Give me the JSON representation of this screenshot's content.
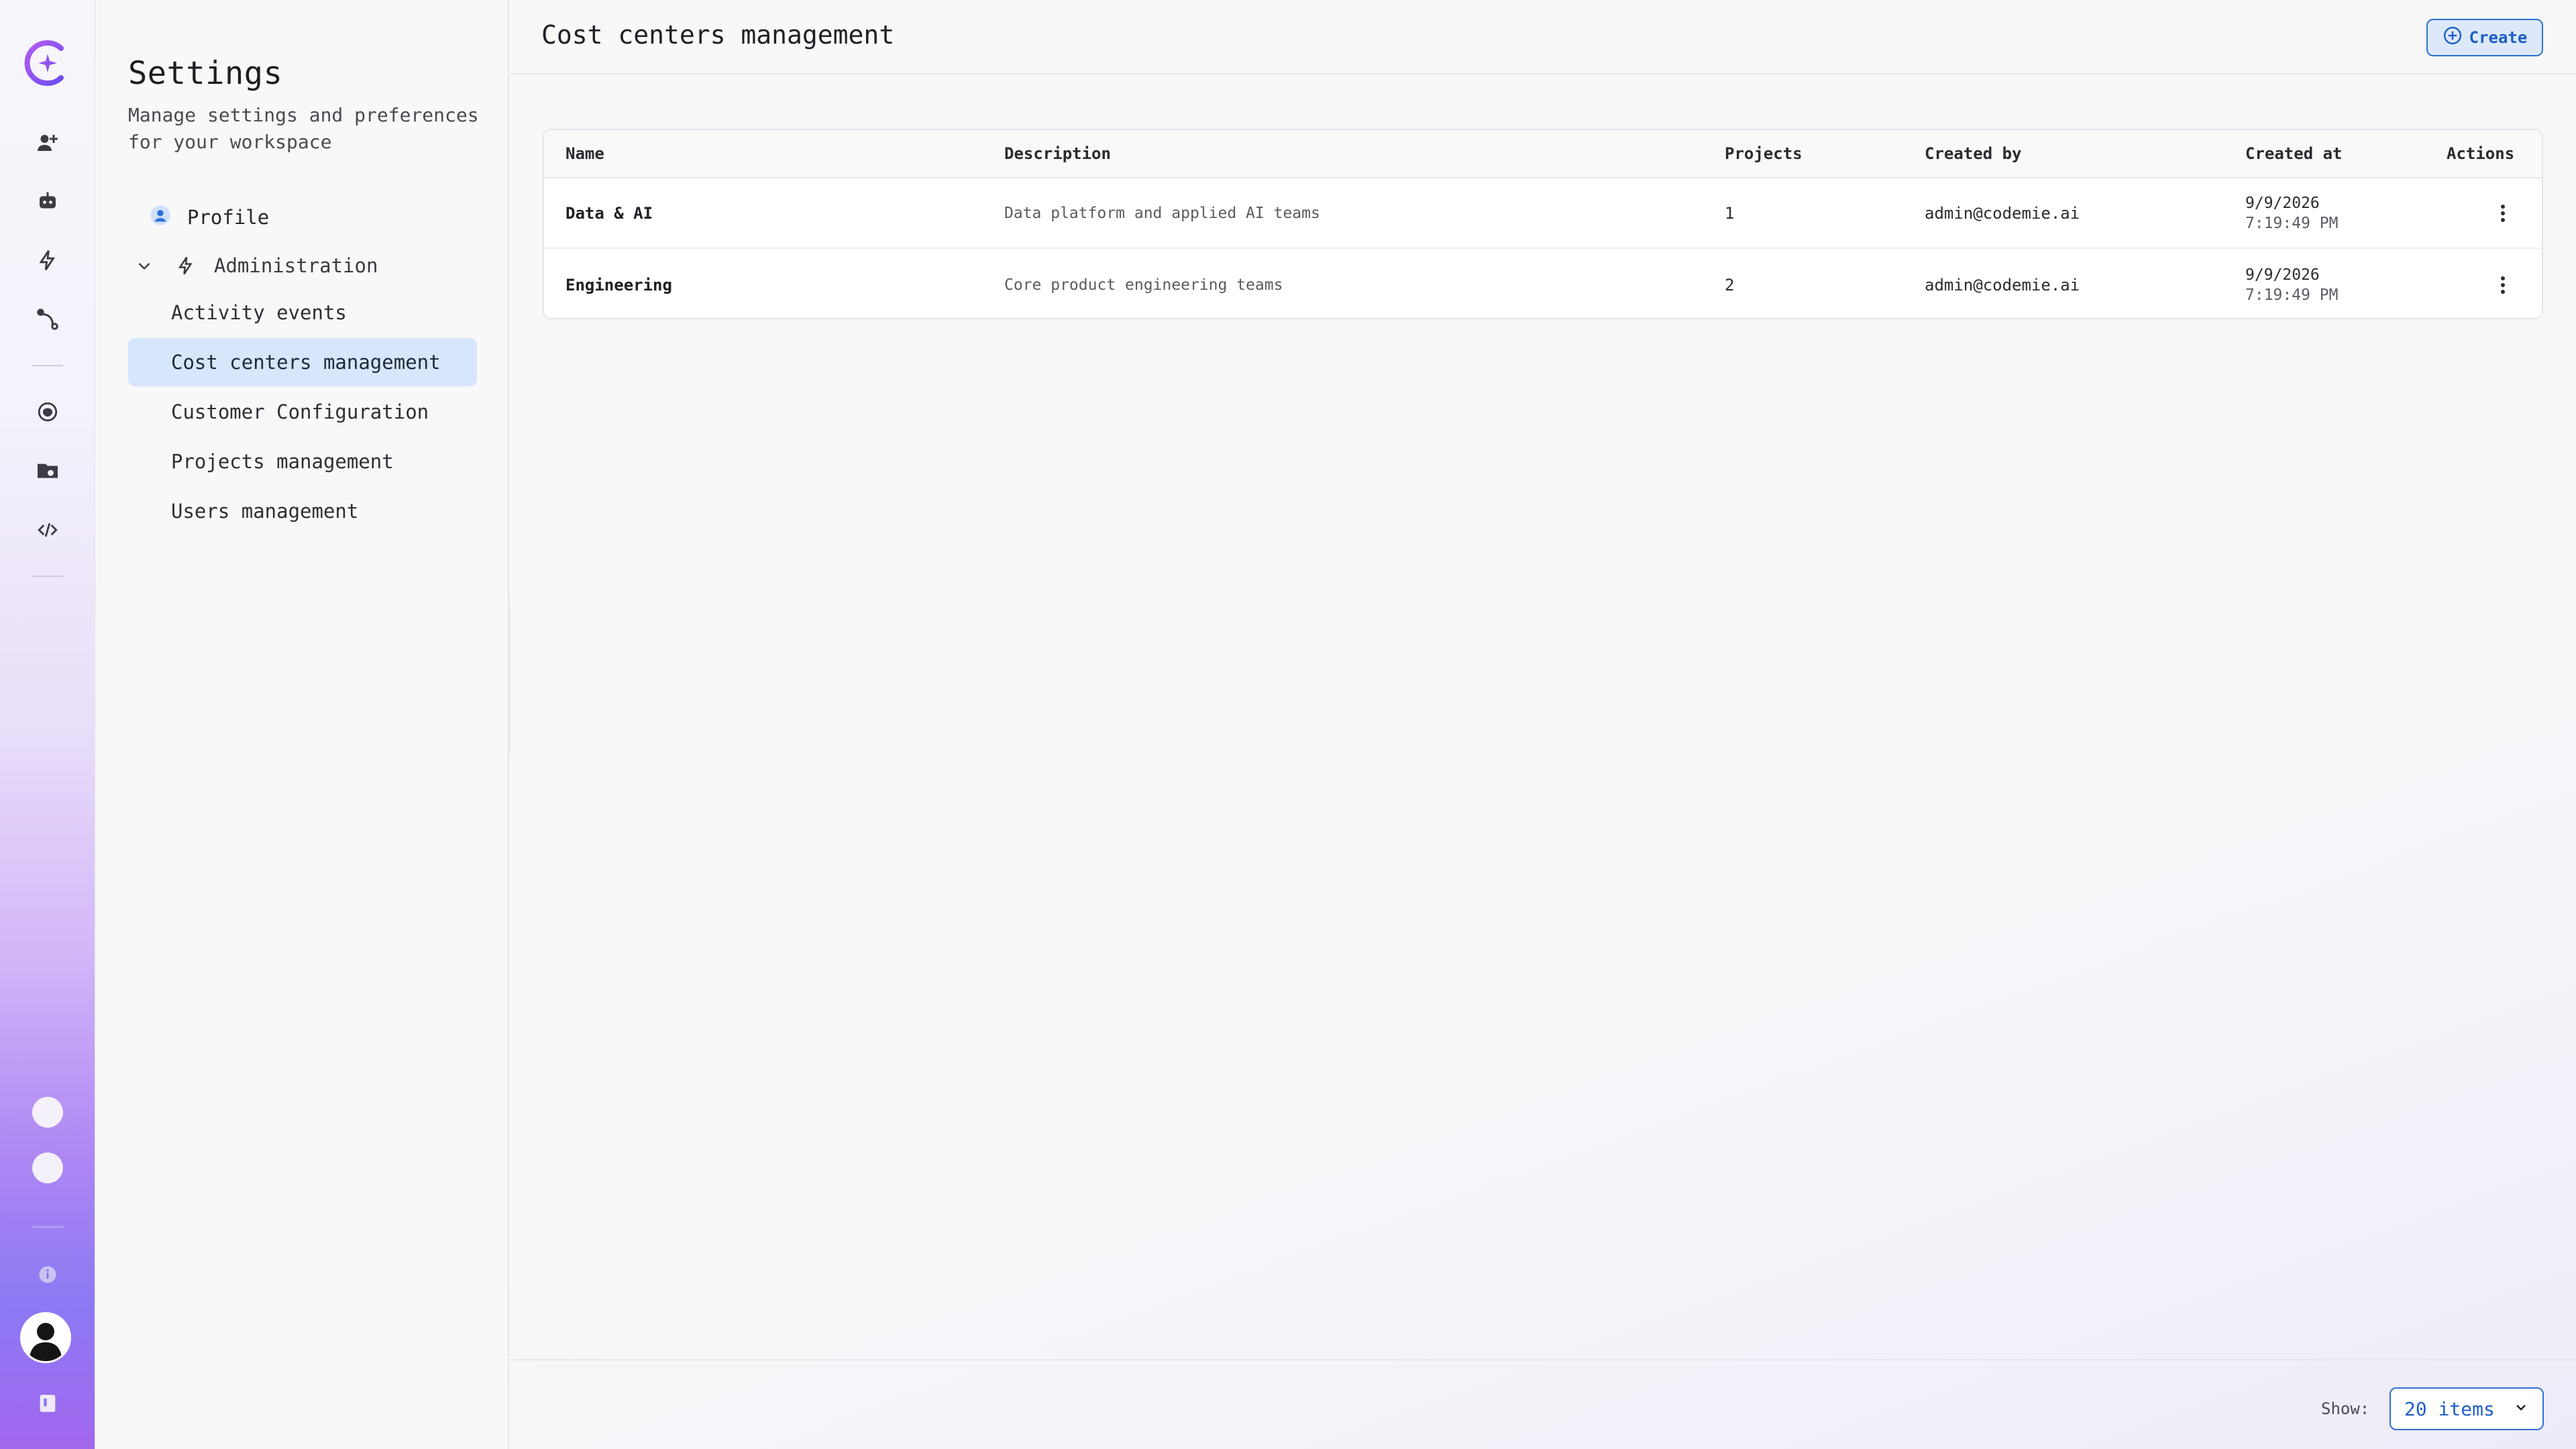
{
  "sidebar": {
    "title": "Settings",
    "subtitle": "Manage settings and preferences for your workspace",
    "profile_label": "Profile",
    "admin_label": "Administration",
    "admin_items": [
      {
        "label": "Activity events"
      },
      {
        "label": "Cost centers management",
        "active": true
      },
      {
        "label": "Customer Configuration"
      },
      {
        "label": "Projects management"
      },
      {
        "label": "Users management"
      }
    ]
  },
  "header": {
    "title": "Cost centers management",
    "create_label": "Create"
  },
  "table": {
    "columns": [
      "Name",
      "Description",
      "Projects",
      "Created by",
      "Created at",
      "Actions"
    ],
    "rows": [
      {
        "name": "Data & AI",
        "description": "Data platform and applied AI teams",
        "projects": "1",
        "created_by": "admin@codemie.ai",
        "created_date": "9/9/2026",
        "created_time": "7:19:49 PM"
      },
      {
        "name": "Engineering",
        "description": "Core product engineering teams",
        "projects": "2",
        "created_by": "admin@codemie.ai",
        "created_date": "9/9/2026",
        "created_time": "7:19:49 PM"
      }
    ]
  },
  "footer": {
    "show_label": "Show:",
    "page_size": "20 items"
  },
  "colors": {
    "accent": "#2e6fd6",
    "active_nav_bg": "#d6e6fb"
  }
}
